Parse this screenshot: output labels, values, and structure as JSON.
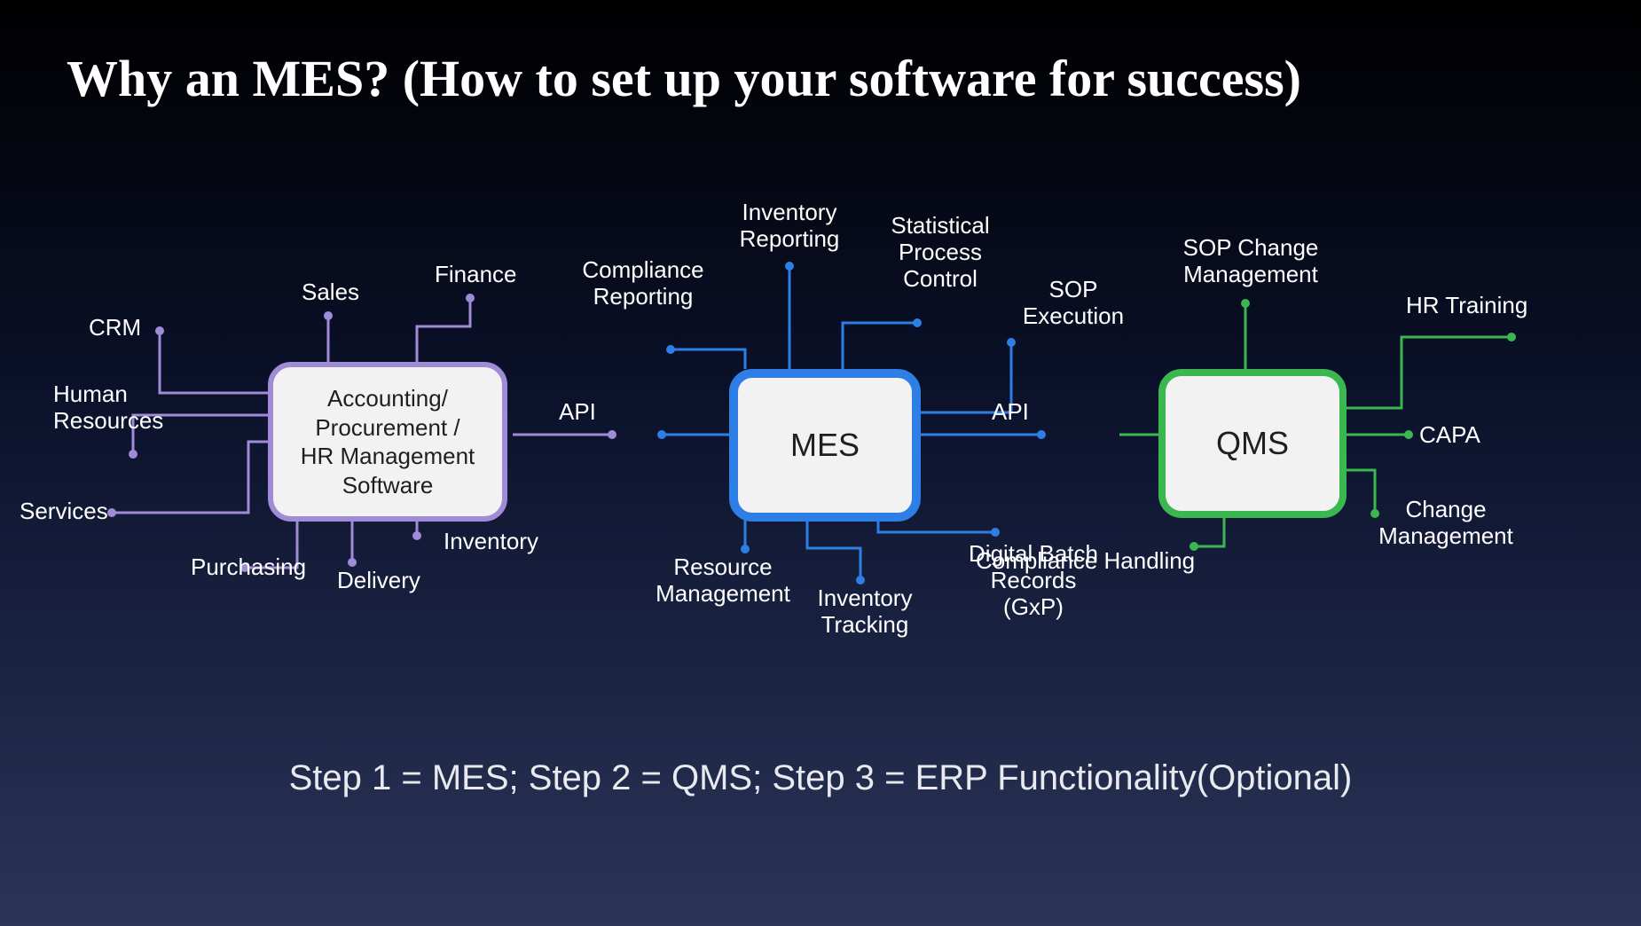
{
  "title": "Why an MES? (How to set up your software for success)",
  "footer": "Step 1 = MES; Step 2 = QMS; Step 3 = ERP Functionality(Optional)",
  "colors": {
    "erp": "#9f8bd6",
    "mes": "#2d7fe6",
    "qms": "#3ab84f"
  },
  "nodes": {
    "erp": {
      "label": "Accounting/\nProcurement /\nHR Management\nSoftware"
    },
    "mes": {
      "label": "MES"
    },
    "qms": {
      "label": "QMS"
    }
  },
  "labels": {
    "erp": {
      "crm": "CRM",
      "human_resources": "Human\nResources",
      "services": "Services",
      "sales": "Sales",
      "finance": "Finance",
      "inventory": "Inventory",
      "delivery": "Delivery",
      "purchasing": "Purchasing",
      "api": "API"
    },
    "mes": {
      "compliance_reporting": "Compliance\nReporting",
      "inventory_reporting": "Inventory\nReporting",
      "statistical_process_control": "Statistical\nProcess\nControl",
      "sop_execution": "SOP\nExecution",
      "resource_management": "Resource\nManagement",
      "inventory_tracking": "Inventory\nTracking",
      "digital_batch_records": "Digital Batch\nRecords\n(GxP)",
      "api": "API"
    },
    "qms": {
      "sop_change_management": "SOP Change\nManagement",
      "hr_training": "HR Training",
      "capa": "CAPA",
      "change_management": "Change\nManagement",
      "compliance_handling": "Compliance Handling"
    }
  }
}
